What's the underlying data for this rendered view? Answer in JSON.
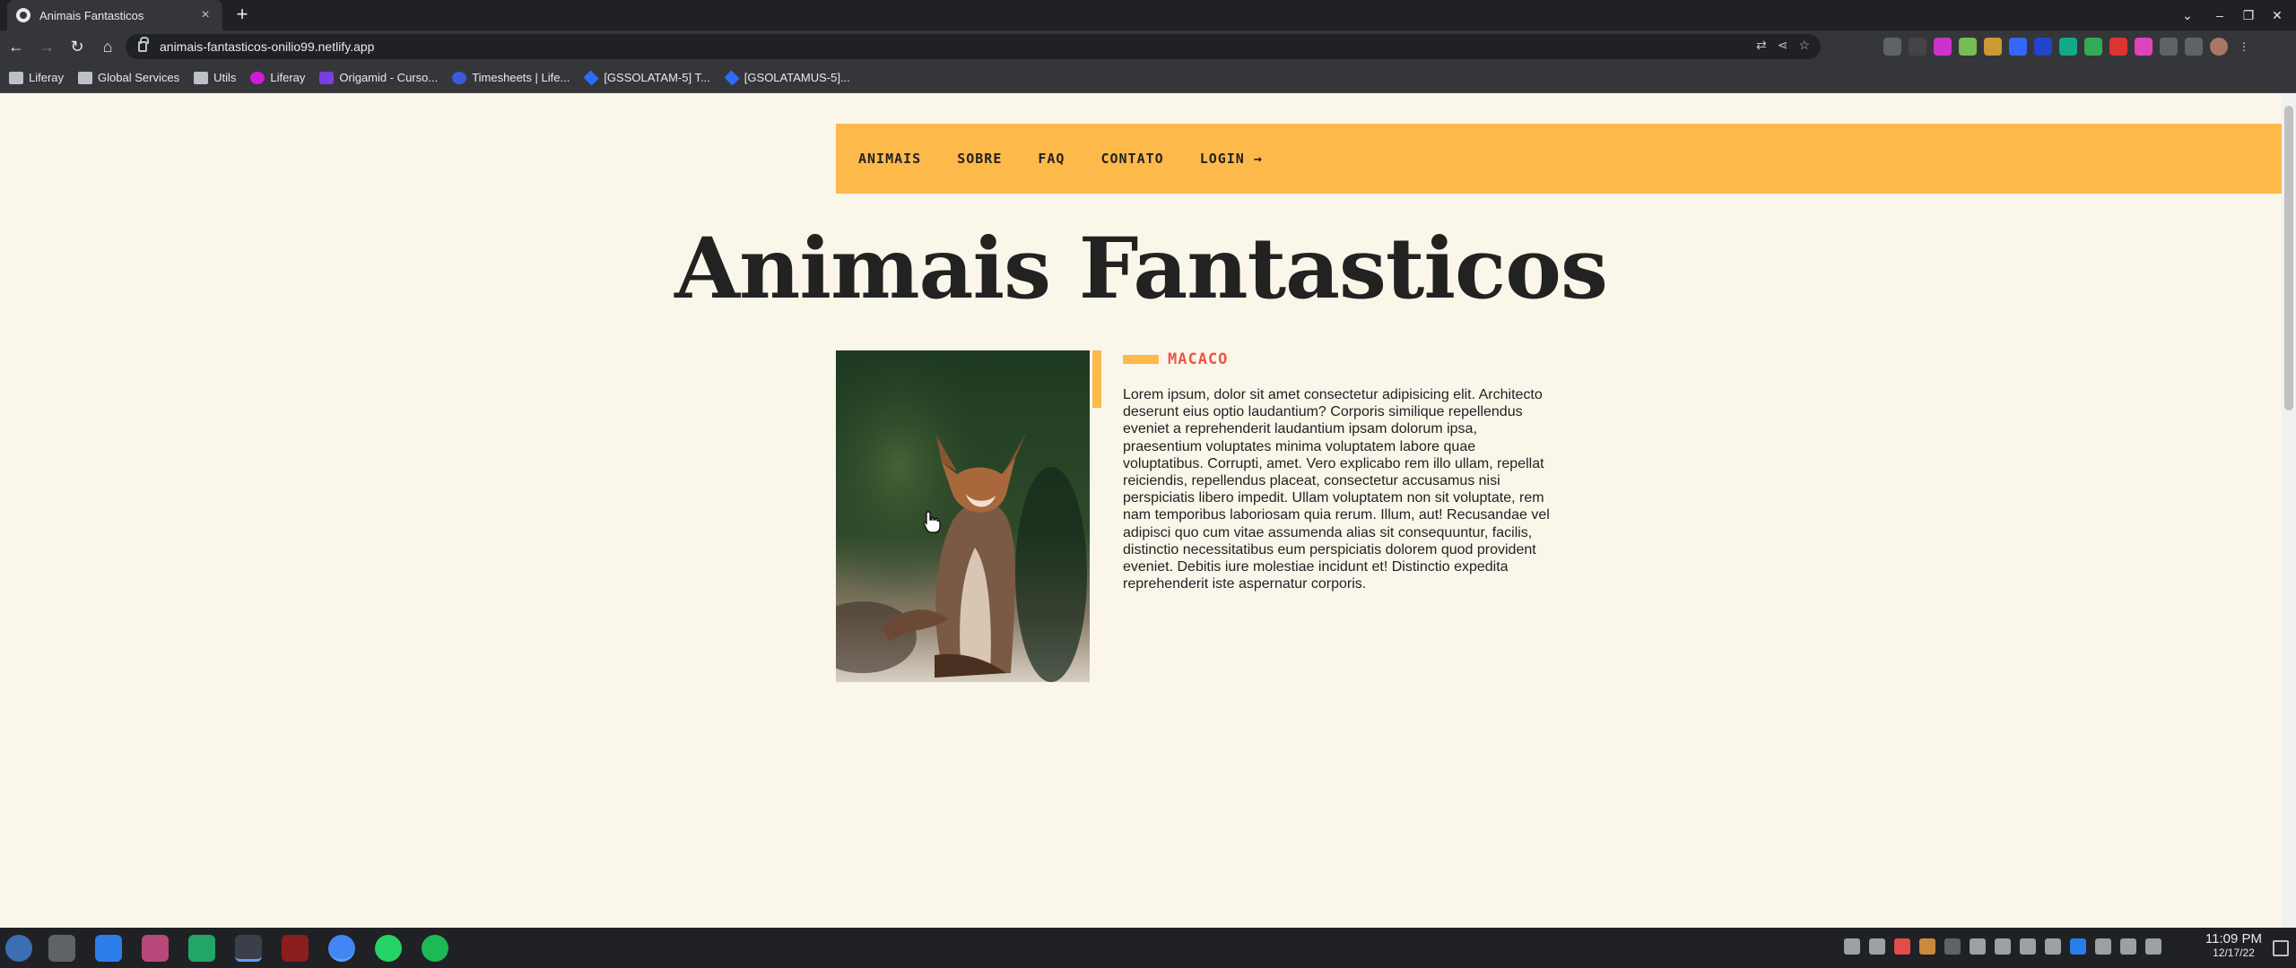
{
  "browser": {
    "tab_title": "Animais Fantasticos",
    "new_tab": "+",
    "url": "animais-fantasticos-onilio99.netlify.app",
    "bookmarks": [
      {
        "label": "Liferay",
        "icon": "folder-icon"
      },
      {
        "label": "Global Services",
        "icon": "folder-icon"
      },
      {
        "label": "Utils",
        "icon": "folder-icon"
      },
      {
        "label": "Liferay",
        "icon": "liferay-icon"
      },
      {
        "label": "Origamid - Curso...",
        "icon": "origamid-icon"
      },
      {
        "label": "Timesheets | Life...",
        "icon": "globe-icon"
      },
      {
        "label": "[GSSOLATAM-5] T...",
        "icon": "jira-icon"
      },
      {
        "label": "[GSOLATAMUS-5]...",
        "icon": "jira-icon"
      }
    ]
  },
  "site": {
    "menu": [
      "ANIMAIS",
      "SOBRE",
      "FAQ",
      "CONTATO",
      "LOGIN →"
    ],
    "title": "Animais Fantasticos",
    "animal": {
      "name": "MACACO",
      "description": "Lorem ipsum, dolor sit amet consectetur adipisicing elit. Architecto deserunt eius optio laudantium? Corporis similique repellendus eveniet a reprehenderit laudantium ipsam dolorum ipsa, praesentium voluptates minima voluptatem labore quae voluptatibus. Corrupti, amet. Vero explicabo rem illo ullam, repellat reiciendis, repellendus placeat, consectetur accusamus nisi perspiciatis libero impedit. Ullam voluptatem non sit voluptate, rem nam temporibus laboriosam quia rerum. Illum, aut! Recusandae vel adipisci quo cum vitae assumenda alias sit consequuntur, facilis, distinctio necessitatibus eum perspiciatis dolorem quod provident eveniet. Debitis iure molestiae incidunt et! Distinctio expedita reprehenderit iste aspernatur corporis."
    },
    "colors": {
      "accent": "#feb94b",
      "title_red": "#e54444",
      "background": "#faf6ea"
    }
  },
  "taskbar": {
    "time": "11:09 PM",
    "date": "12/17/22"
  }
}
